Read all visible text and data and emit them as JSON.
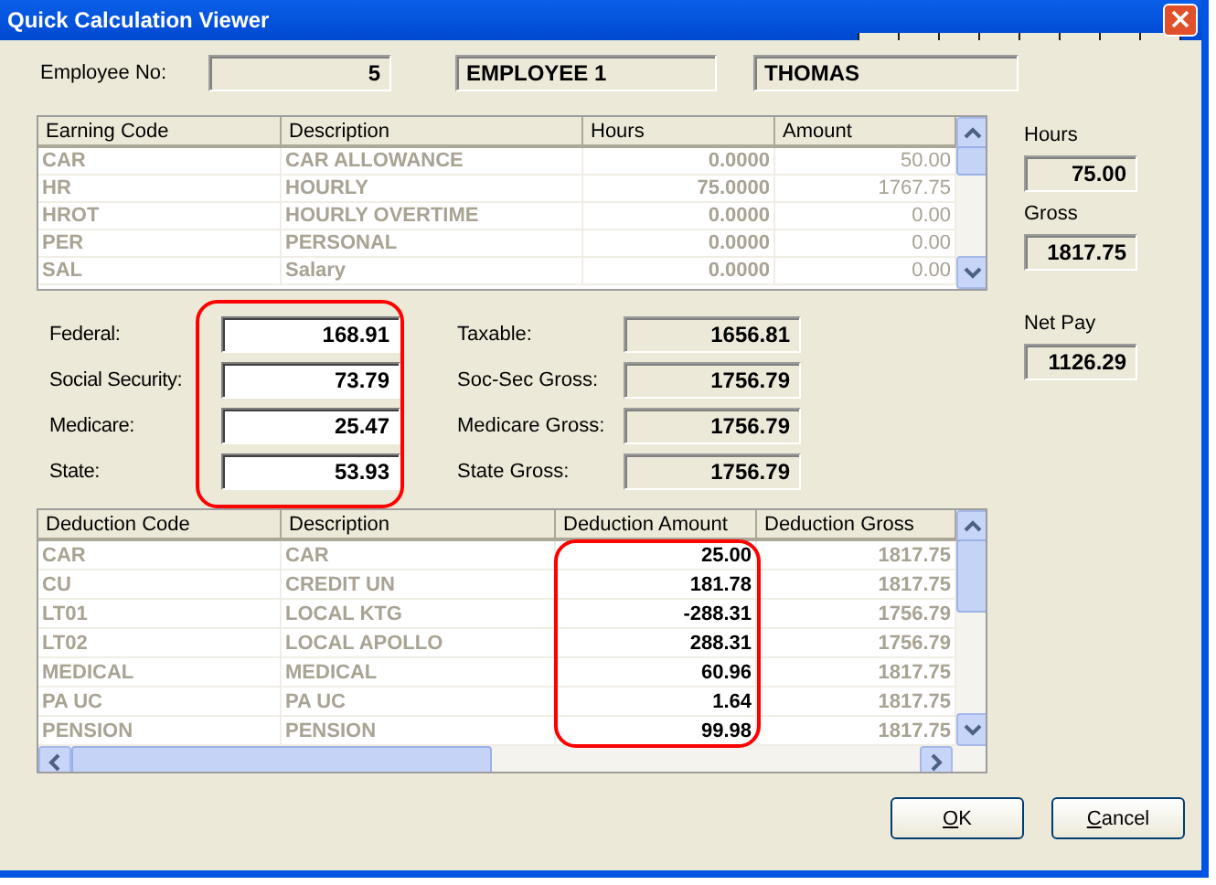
{
  "window": {
    "title": "Quick Calculation Viewer"
  },
  "employee": {
    "label": "Employee No:",
    "number": "5",
    "name": "EMPLOYEE 1",
    "last_name": "THOMAS"
  },
  "earnings": {
    "columns": [
      "Earning Code",
      "Description",
      "Hours",
      "Amount"
    ],
    "rows": [
      {
        "code": "CAR",
        "description": "CAR ALLOWANCE",
        "hours": "0.0000",
        "amount": "50.00"
      },
      {
        "code": "HR",
        "description": "HOURLY",
        "hours": "75.0000",
        "amount": "1767.75"
      },
      {
        "code": "HROT",
        "description": "HOURLY OVERTIME",
        "hours": "0.0000",
        "amount": "0.00"
      },
      {
        "code": "PER",
        "description": "PERSONAL",
        "hours": "0.0000",
        "amount": "0.00"
      },
      {
        "code": "SAL",
        "description": "Salary",
        "hours": "0.0000",
        "amount": "0.00"
      }
    ]
  },
  "totals": [
    {
      "label": "Hours",
      "value": "75.00"
    },
    {
      "label": "Gross",
      "value": "1817.75"
    },
    {
      "label": "Net Pay",
      "value": "1126.29"
    }
  ],
  "taxes": [
    {
      "label": "Federal:",
      "value": "168.91"
    },
    {
      "label": "Social Security:",
      "value": "73.79"
    },
    {
      "label": "Medicare:",
      "value": "25.47"
    },
    {
      "label": "State:",
      "value": "53.93"
    }
  ],
  "wages": [
    {
      "label": "Taxable:",
      "value": "1656.81"
    },
    {
      "label": "Soc-Sec Gross:",
      "value": "1756.79"
    },
    {
      "label": "Medicare Gross:",
      "value": "1756.79"
    },
    {
      "label": "State Gross:",
      "value": "1756.79"
    }
  ],
  "deductions": {
    "columns": [
      "Deduction Code",
      "Description",
      "Deduction Amount",
      "Deduction Gross"
    ],
    "rows": [
      {
        "code": "CAR",
        "description": "CAR",
        "amount": "25.00",
        "gross": "1817.75"
      },
      {
        "code": "CU",
        "description": "CREDIT UN",
        "amount": "181.78",
        "gross": "1817.75"
      },
      {
        "code": "LT01",
        "description": "LOCAL KTG",
        "amount": "-288.31",
        "gross": "1756.79"
      },
      {
        "code": "LT02",
        "description": "LOCAL APOLLO",
        "amount": "288.31",
        "gross": "1756.79"
      },
      {
        "code": "MEDICAL",
        "description": "MEDICAL",
        "amount": "60.96",
        "gross": "1817.75"
      },
      {
        "code": "PA UC",
        "description": "PA UC",
        "amount": "1.64",
        "gross": "1817.75"
      },
      {
        "code": "PENSION",
        "description": "PENSION",
        "amount": "99.98",
        "gross": "1817.75"
      }
    ]
  },
  "buttons": [
    {
      "label": "OK",
      "underline_first": true
    },
    {
      "label": "Cancel",
      "underline_first": true
    }
  ]
}
